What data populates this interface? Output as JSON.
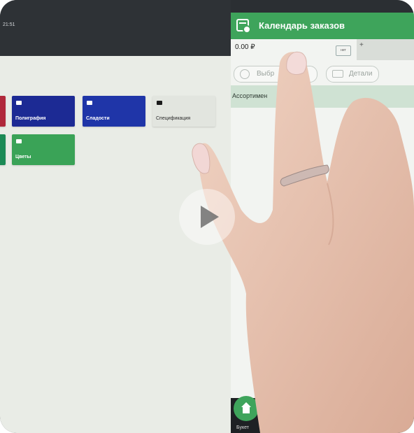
{
  "pos": {
    "time": "21:51",
    "tiles": [
      {
        "label": "Полиграфия",
        "color": "#1c2a94"
      },
      {
        "label": "Сладости",
        "color": "#1f35a8"
      },
      {
        "label": "Спецификация",
        "color": "#e2e5df"
      },
      {
        "label": "Цветы",
        "color": "#3aa357"
      }
    ],
    "edge_tiles": [
      {
        "color": "#b0293b"
      },
      {
        "color": "#1b8a55"
      }
    ]
  },
  "panel": {
    "title": "Календарь заказов",
    "amount": "0.00 ₽",
    "small_button": "нет",
    "plus": "+",
    "pill_client": "Выбр",
    "pill_details": "Детали",
    "assortment": "Ассортимен",
    "home_label": "Букет"
  },
  "colors": {
    "accent_green": "#3ea45b",
    "skin": "#e6c4b2"
  },
  "icons": [
    "calendar-icon",
    "folder-icon",
    "user-icon",
    "truck-icon",
    "home-icon",
    "play-icon"
  ]
}
